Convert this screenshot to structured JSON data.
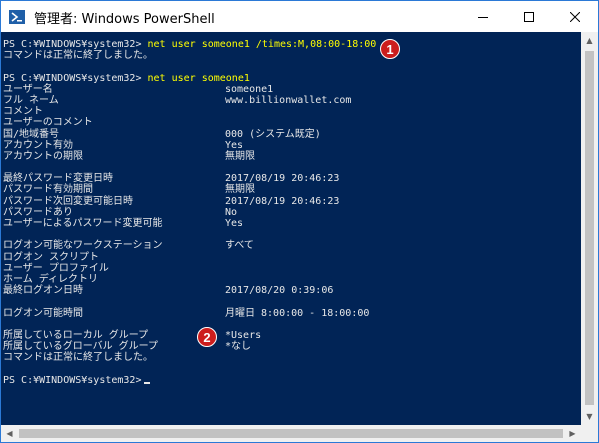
{
  "window": {
    "title": "管理者: Windows PowerShell",
    "controls": {
      "minimize": "─",
      "maximize": "☐",
      "close": "✕"
    },
    "icon": "powershell-icon"
  },
  "console": {
    "prompt": "PS C:¥WINDOWS¥system32>",
    "cmd1": "net user someone1 /times:M,08:00-18:00",
    "success1": "コマンドは正常に終了しました。",
    "cmd2": "net user someone1",
    "fields": [
      {
        "label": "ユーザー名",
        "value": "someone1"
      },
      {
        "label": "フル ネーム",
        "value": "www.billionwallet.com"
      },
      {
        "label": "コメント",
        "value": ""
      },
      {
        "label": "ユーザーのコメント",
        "value": ""
      },
      {
        "label": "国/地域番号",
        "value": "000 (システム既定)"
      },
      {
        "label": "アカウント有効",
        "value": "Yes"
      },
      {
        "label": "アカウントの期限",
        "value": "無期限"
      },
      {
        "label": "最終パスワード変更日時",
        "value": "2017/08/19 20:46:23"
      },
      {
        "label": "パスワード有効期間",
        "value": "無期限"
      },
      {
        "label": "パスワード次回変更可能日時",
        "value": "2017/08/19 20:46:23"
      },
      {
        "label": "パスワードあり",
        "value": "No"
      },
      {
        "label": "ユーザーによるパスワード変更可能",
        "value": "Yes"
      },
      {
        "label": "ログオン可能なワークステーション",
        "value": "すべて"
      },
      {
        "label": "ログオン スクリプト",
        "value": ""
      },
      {
        "label": "ユーザー プロファイル",
        "value": ""
      },
      {
        "label": "ホーム ディレクトリ",
        "value": ""
      },
      {
        "label": "最終ログオン日時",
        "value": "2017/08/20 0:39:06"
      },
      {
        "label": "ログオン可能時間",
        "value": "月曜日 8:00:00 - 18:00:00"
      },
      {
        "label": "所属しているローカル グループ",
        "value": "*Users"
      },
      {
        "label": "所属しているグローバル グループ",
        "value": "*なし"
      }
    ],
    "success2": "コマンドは正常に終了しました。"
  },
  "markers": [
    "1",
    "2"
  ],
  "colors": {
    "console_bg": "#012456",
    "command": "#ffff00",
    "text": "#e8e8e8",
    "marker": "#cc1d1d"
  }
}
